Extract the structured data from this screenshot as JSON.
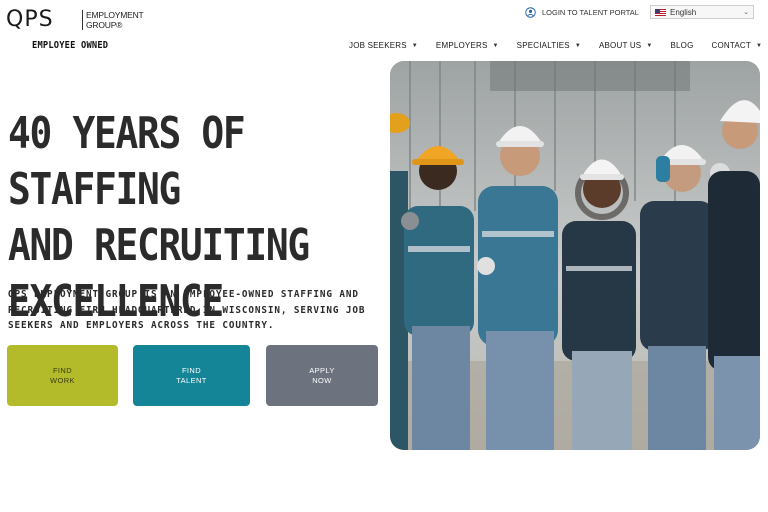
{
  "logo": {
    "brand": "QPS",
    "line1": "EMPLOYMENT",
    "line2": "GROUP®",
    "tagline": "EMPLOYEE OWNED"
  },
  "topbar": {
    "login_label": "LOGIN TO TALENT PORTAL",
    "language": "English"
  },
  "nav": {
    "items": [
      {
        "label": "JOB SEEKERS",
        "dropdown": true
      },
      {
        "label": "EMPLOYERS",
        "dropdown": true
      },
      {
        "label": "SPECIALTIES",
        "dropdown": true
      },
      {
        "label": "ABOUT US",
        "dropdown": true
      },
      {
        "label": "BLOG",
        "dropdown": false
      },
      {
        "label": "CONTACT",
        "dropdown": true
      }
    ]
  },
  "hero": {
    "title_lines": [
      "40 YEARS OF STAFFING",
      "AND RECRUITING",
      "EXCELLENCE"
    ],
    "subtitle": "QPS EMPLOYMENT GROUP IS AN EMPLOYEE-OWNED STAFFING AND RECRUITING FIRM HEADQUARTERED IN WISCONSIN, SERVING JOB SEEKERS AND EMPLOYERS ACROSS THE COUNTRY.",
    "buttons": {
      "find_work": {
        "line1": "FIND",
        "line2": "WORK"
      },
      "find_talent": {
        "line1": "FIND",
        "line2": "TALENT"
      },
      "apply_now": {
        "line1": "APPLY",
        "line2": "NOW"
      }
    }
  },
  "colors": {
    "find_work": "#b4bb2a",
    "find_talent": "#138597",
    "apply_now": "#6c737e"
  }
}
